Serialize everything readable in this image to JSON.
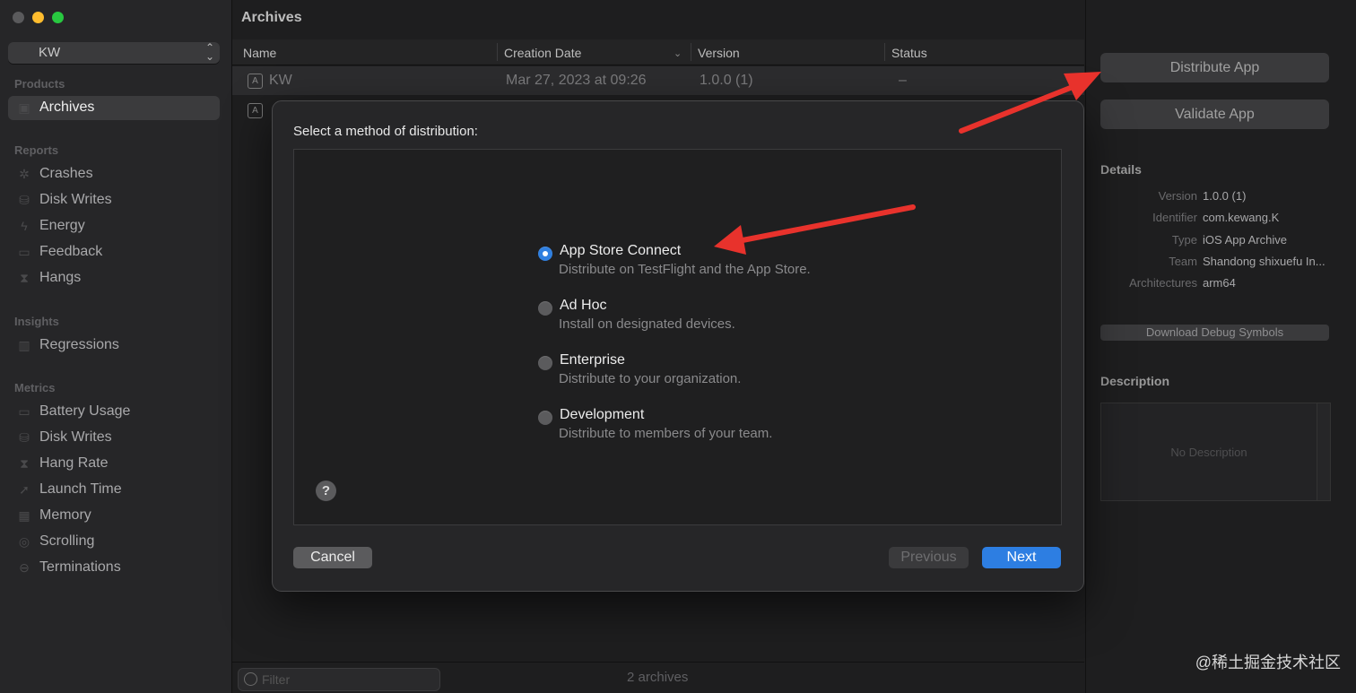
{
  "sidebar": {
    "scheme": "KW",
    "sections": {
      "products": "Products",
      "reports": "Reports",
      "insights": "Insights",
      "metrics": "Metrics"
    },
    "products_items": [
      {
        "label": "Archives",
        "icon": "archive-icon"
      }
    ],
    "reports_items": [
      {
        "label": "Crashes",
        "icon": "crash-icon"
      },
      {
        "label": "Disk Writes",
        "icon": "disk-icon"
      },
      {
        "label": "Energy",
        "icon": "bolt-icon"
      },
      {
        "label": "Feedback",
        "icon": "feedback-icon"
      },
      {
        "label": "Hangs",
        "icon": "hourglass-icon"
      }
    ],
    "insights_items": [
      {
        "label": "Regressions",
        "icon": "chart-icon"
      }
    ],
    "metrics_items": [
      {
        "label": "Battery Usage",
        "icon": "battery-icon"
      },
      {
        "label": "Disk Writes",
        "icon": "disk-icon"
      },
      {
        "label": "Hang Rate",
        "icon": "hourglass-icon"
      },
      {
        "label": "Launch Time",
        "icon": "rocket-icon"
      },
      {
        "label": "Memory",
        "icon": "memory-icon"
      },
      {
        "label": "Scrolling",
        "icon": "scroll-icon"
      },
      {
        "label": "Terminations",
        "icon": "stop-icon"
      }
    ]
  },
  "main": {
    "title": "Archives",
    "columns": [
      "Name",
      "Creation Date",
      "Version",
      "Status"
    ],
    "rows": [
      {
        "name": "KW",
        "date": "Mar 27, 2023 at 09:26",
        "version": "1.0.0 (1)",
        "status": "–"
      }
    ],
    "filter_placeholder": "Filter",
    "count": "2 archives"
  },
  "right": {
    "distribute": "Distribute App",
    "validate": "Validate App",
    "details_title": "Details",
    "details": [
      {
        "k": "Version",
        "v": "1.0.0 (1)"
      },
      {
        "k": "Identifier",
        "v": "com.kewang.K"
      },
      {
        "k": "Type",
        "v": "iOS App Archive"
      },
      {
        "k": "Team",
        "v": "Shandong shixuefu In..."
      },
      {
        "k": "Architectures",
        "v": "arm64"
      }
    ],
    "download_symbols": "Download Debug Symbols",
    "description_title": "Description",
    "description_placeholder": "No Description"
  },
  "modal": {
    "prompt": "Select a method of distribution:",
    "options": [
      {
        "title": "App Store Connect",
        "desc": "Distribute on TestFlight and the App Store.",
        "selected": true
      },
      {
        "title": "Ad Hoc",
        "desc": "Install on designated devices.",
        "selected": false
      },
      {
        "title": "Enterprise",
        "desc": "Distribute to your organization.",
        "selected": false
      },
      {
        "title": "Development",
        "desc": "Distribute to members of your team.",
        "selected": false
      }
    ],
    "help": "?",
    "cancel": "Cancel",
    "previous": "Previous",
    "next": "Next"
  },
  "watermark": "@稀土掘金技术社区",
  "colors": {
    "accent": "#2d7ee2",
    "annotation": "#e8322c"
  }
}
